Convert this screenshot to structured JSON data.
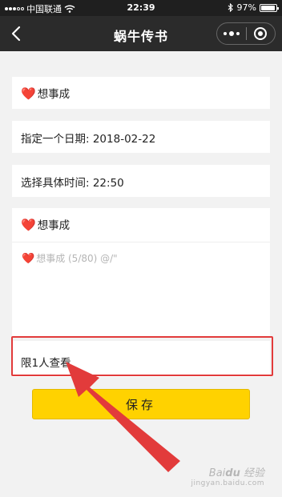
{
  "status_bar": {
    "carrier": "中国联通",
    "time": "22:39",
    "battery": "97%",
    "battery_level": 0.97,
    "icons": [
      "signal-dots",
      "wifi",
      "bluetooth",
      "battery"
    ]
  },
  "nav": {
    "title": "蜗牛传书",
    "icons": [
      "back-chevron",
      "more-dots",
      "close-target"
    ]
  },
  "form": {
    "title_field": {
      "heart": "❤️",
      "text": "想事成"
    },
    "date_field": {
      "label": "指定一个日期",
      "separator": ": ",
      "value": "2018-02-22"
    },
    "time_field": {
      "label": "选择具体时间",
      "separator": ": ",
      "value": "22:50"
    },
    "content_field": {
      "header_heart": "❤️",
      "header_text": "想事成",
      "placeholder_heart": "❤️",
      "placeholder_text": "想事成 (5/80) @/\""
    },
    "limit_field": {
      "text": "限1人查看"
    },
    "save_label": "保存"
  },
  "annotation": {
    "highlight_color": "#e23b3b",
    "arrow_color": "#e23b3b"
  },
  "watermark": {
    "brand": "Baidu 经验",
    "url": "jingyan.baidu.com"
  },
  "colors": {
    "nav_bg": "#2b2b2b",
    "page_bg": "#f2f2f2",
    "button": "#ffd200"
  }
}
